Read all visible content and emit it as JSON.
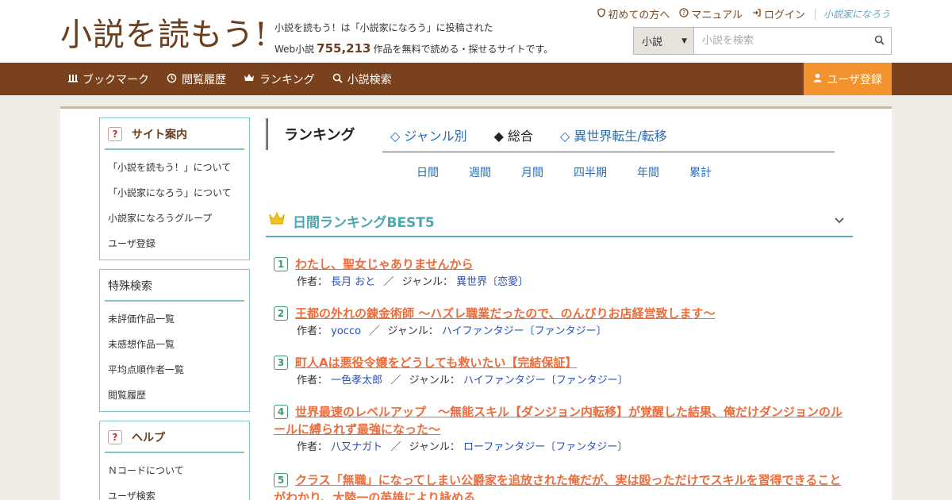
{
  "header": {
    "logo_text": "小説を読もう!",
    "tagline_line1": "小説を読もう！は「小説家になろう」に投稿された",
    "tagline_prefix": "Web小説",
    "work_count": "755,213",
    "tagline_suffix": "作品を無料で読める・探せるサイトです。",
    "links": {
      "beginner": "初めての方へ",
      "manual": "マニュアル",
      "login": "ログイン",
      "brand": "小説家になろう"
    },
    "search": {
      "category": "小説",
      "placeholder": "小説を検索"
    }
  },
  "nav": {
    "bookmark": "ブックマーク",
    "history": "閲覧履歴",
    "ranking": "ランキング",
    "search": "小説検索",
    "register": "ユーザ登録"
  },
  "sidebar": {
    "site_guide": {
      "title": "サイト案内",
      "items": [
        "「小説を読もう！」について",
        "「小説家になろう」について",
        "小説家になろうグループ",
        "ユーザ登録"
      ]
    },
    "special": {
      "title": "特殊検索",
      "items": [
        "未評価作品一覧",
        "未感想作品一覧",
        "平均点順作者一覧",
        "閲覧履歴"
      ]
    },
    "help": {
      "title": "ヘルプ",
      "items": [
        "Ｎコードについて",
        "ユーザ検索"
      ]
    }
  },
  "ranking": {
    "tab": "ランキング",
    "links": [
      "◇ ジャンル別",
      "◆ 総合",
      "◇ 異世界転生/転移"
    ],
    "periods": [
      "日間",
      "週間",
      "月間",
      "四半期",
      "年間",
      "累計"
    ],
    "best_title": "日間ランキングBEST5",
    "author_label": "作者：",
    "genre_label": "ジャンル：",
    "entries": [
      {
        "rank": "1",
        "title": "わたし、聖女じゃありませんから",
        "author": "長月 おと",
        "genre": "異世界〔恋愛〕"
      },
      {
        "rank": "2",
        "title": "王都の外れの錬金術師 ～ハズレ職業だったので、のんびりお店経営致します～",
        "author": "yocco",
        "genre": "ハイファンタジー〔ファンタジー〕"
      },
      {
        "rank": "3",
        "title": "町人Aは悪役令嬢をどうしても救いたい【完結保証】",
        "author": "一色孝太郎",
        "genre": "ハイファンタジー〔ファンタジー〕"
      },
      {
        "rank": "4",
        "title_line1": "世界最速のレベルアップ　～無能スキル【ダンジョン内転移】が覚醒した結果、俺だけダンジョンのル",
        "title_line2": "ールに縛られず最強になった～",
        "author": "八又ナガト",
        "genre": "ローファンタジー〔ファンタジー〕"
      },
      {
        "rank": "5",
        "title_line1": "クラス「無職」になってしまい公爵家を追放された俺だが、実は殴っただけでスキルを習得できること",
        "title_line2": "がわかり、大陸一の英雄により詠める"
      }
    ]
  }
}
